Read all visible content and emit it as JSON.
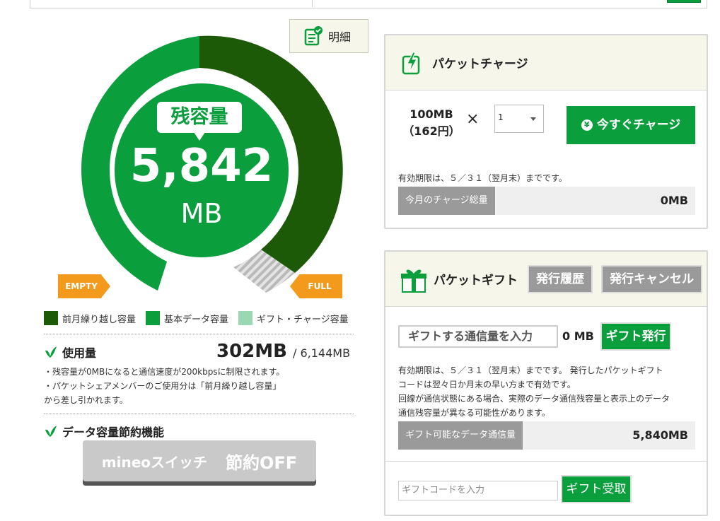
{
  "gauge": {
    "remaining_label": "残容量",
    "remaining_value": "5,842",
    "remaining_unit": "MB",
    "empty_label": "EMPTY",
    "full_label": "FULL"
  },
  "detail_button": {
    "label": "明細",
    "icon": "checklist-icon"
  },
  "legend": [
    {
      "label": "前月繰り越し容量",
      "color": "#1d5a08"
    },
    {
      "label": "基本データ容量",
      "color": "#0a9e3d"
    },
    {
      "label": "ギフト・チャージ容量",
      "color": "#9ad8b4"
    }
  ],
  "usage": {
    "title": "使用量",
    "value": "302MB",
    "total": "/ 6,144MB",
    "notes": [
      "・残容量が0MBになると通信速度が200kbpsに制限されます。",
      "・パケットシェアメンバーのご使用分は「前月繰り越し容量」",
      "から差し引かれます。"
    ]
  },
  "saving": {
    "title": "データ容量節約機能",
    "brand": "mineoスイッチ",
    "state": "節約OFF"
  },
  "charge": {
    "title": "パケットチャージ",
    "amount_line1": "100MB",
    "amount_line2": "（162円）",
    "times": "×",
    "quantity": "1",
    "button": "今すぐチャージ",
    "expiry_note": "有効期限は、５／３１（翌月末）までです。",
    "total_label": "今月のチャージ総量",
    "total_value": "0MB"
  },
  "gift": {
    "title": "パケットギフト",
    "history_button": "発行履歴",
    "cancel_button": "発行キャンセル",
    "amount_placeholder": "ギフトする通信量を入力",
    "amount_unit": "0 MB",
    "issue_button": "ギフト発行",
    "notes": [
      "有効期限は、５／３１（翌月末）までです。 発行したパケットギフト",
      "コードは翌々日か月末の早い方まで有効です。",
      "回線が通信状態にある場合、実際のデータ通信残容量と表示上のデータ",
      "通信残容量が異なる可能性があります。"
    ],
    "available_label": "ギフト可能なデータ通信量",
    "available_value": "5,840MB",
    "code_placeholder": "ギフトコードを入力",
    "receive_button": "ギフト受取"
  }
}
